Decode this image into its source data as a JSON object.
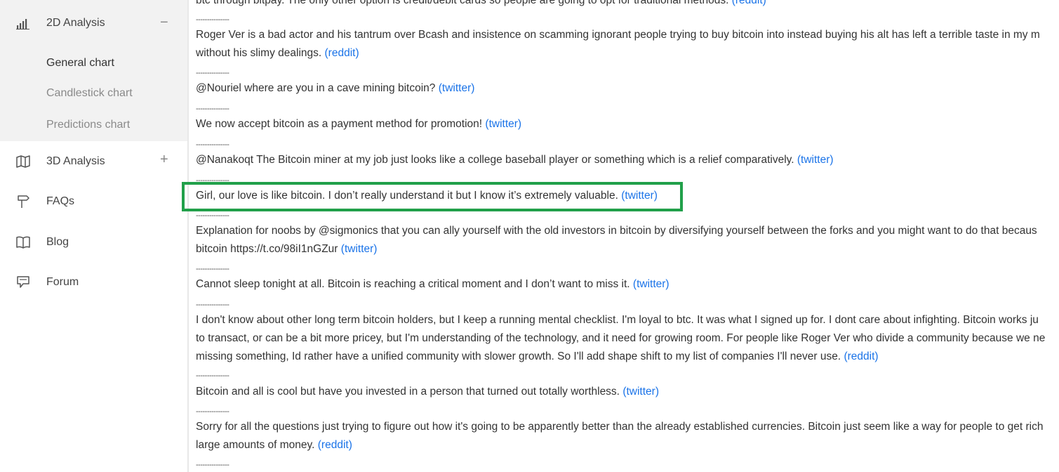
{
  "sidebar": {
    "items": [
      {
        "label": "2D Analysis",
        "icon": "bar-chart-icon",
        "toggle": "−",
        "expanded": true,
        "children": [
          {
            "label": "General chart",
            "active": true
          },
          {
            "label": "Candlestick chart",
            "active": false
          },
          {
            "label": "Predictions chart",
            "active": false
          }
        ]
      },
      {
        "label": "3D Analysis",
        "icon": "map-icon",
        "toggle": "+"
      },
      {
        "label": "FAQs",
        "icon": "signpost-icon"
      },
      {
        "label": "Blog",
        "icon": "book-icon"
      },
      {
        "label": "Forum",
        "icon": "chat-icon"
      }
    ]
  },
  "feed": {
    "separator": "---------------",
    "entries": [
      {
        "lines": [
          "btc through bitpay. The only other option is credit/debit cards so people are going to opt for traditional methods."
        ],
        "source": "(reddit)"
      },
      {
        "lines": [
          "Roger Ver is a bad actor and his tantrum over Bcash and insistence on scamming ignorant people trying to buy bitcoin into instead buying his alt has left a terrible taste in my m",
          "without his slimy dealings."
        ],
        "source": "(reddit)"
      },
      {
        "lines": [
          "@Nouriel where are you in a cave mining bitcoin?"
        ],
        "source": "(twitter)"
      },
      {
        "lines": [
          "We now accept bitcoin as a payment method for promotion!"
        ],
        "source": "(twitter)"
      },
      {
        "lines": [
          "@Nanakoqt The Bitcoin miner at my job just looks like a college baseball player or something which is a relief comparatively."
        ],
        "source": "(twitter)"
      },
      {
        "lines": [
          "Girl, our love is like bitcoin. I don’t really understand it but I know it’s extremely valuable."
        ],
        "source": "(twitter)",
        "highlighted": true
      },
      {
        "lines": [
          "Explanation for noobs by @sigmonics that you can ally yourself with the old investors in bitcoin by diversifying yourself between the forks and you might want to do that becaus",
          "bitcoin https://t.co/98iI1nGZur"
        ],
        "source": "(twitter)"
      },
      {
        "lines": [
          "Cannot sleep tonight at all. Bitcoin is reaching a critical moment and I don’t want to miss it."
        ],
        "source": "(twitter)"
      },
      {
        "lines": [
          "I don't know about other long term bitcoin holders, but I keep a running mental checklist. I'm loyal to btc. It was what I signed up for. I dont care about infighting. Bitcoin works ju",
          "to transact, or can be a bit more pricey, but I'm understanding of the technology, and it need for growing room. For people like Roger Ver who divide a community because we ne",
          "missing something, Id rather have a unified community with slower growth. So I'll add shape shift to my list of companies I'll never use."
        ],
        "source": "(reddit)"
      },
      {
        "lines": [
          "Bitcoin and all is cool but have you invested in a person that turned out totally worthless."
        ],
        "source": "(twitter)"
      },
      {
        "lines": [
          "Sorry for all the questions just trying to figure out how it's going to be apparently better than the already established currencies. Bitcoin just seem like a way for people to get rich",
          "large amounts of money."
        ],
        "source": "(reddit)"
      }
    ]
  },
  "colors": {
    "link": "#1a73e8",
    "highlight_border": "#21a04a",
    "sidebar_group_bg": "#f2f2f2"
  }
}
